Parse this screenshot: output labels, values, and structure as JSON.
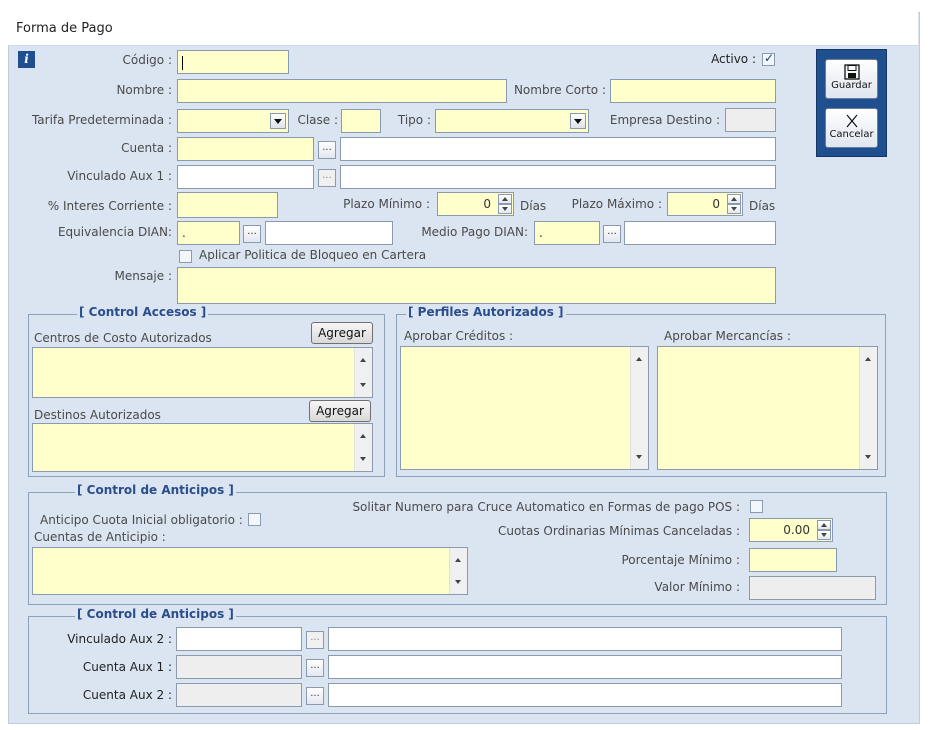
{
  "window": {
    "title": "Forma de Pago"
  },
  "icons": {
    "info": "info-icon",
    "save": "floppy-disk-icon",
    "cancel": "x-cancel-icon"
  },
  "toolbar": {
    "save_label": "Guardar",
    "cancel_label": "Cancelar"
  },
  "form": {
    "codigo_label": "Código :",
    "activo_label": "Activo :",
    "activo_checked": true,
    "nombre_label": "Nombre :",
    "nombre_corto_label": "Nombre Corto :",
    "tarifa_label": "Tarifa Predeterminada :",
    "clase_label": "Clase :",
    "tipo_label": "Tipo :",
    "empresa_destino_label": "Empresa Destino :",
    "cuenta_label": "Cuenta :",
    "vinculado_aux1_label": "Vinculado  Aux 1 :",
    "interes_label": "% Interes Corriente :",
    "plazo_minimo_label": "Plazo Mínimo :",
    "plazo_minimo_value": "0",
    "dias_label": "Días",
    "plazo_maximo_label": "Plazo Máximo :",
    "plazo_maximo_value": "0",
    "equivalencia_label": "Equivalencia DIAN:",
    "equivalencia_value": ".",
    "medio_pago_label": "Medio Pago DIAN:",
    "medio_pago_value": ".",
    "aplicar_politica_label": "Aplicar Politica de Bloqueo en Cartera",
    "mensaje_label": "Mensaje :",
    "ellipsis": "..."
  },
  "control_accesos": {
    "title": "[ Control Accesos ]",
    "centros_label": "Centros de Costo Autorizados",
    "destinos_label": "Destinos Autorizados",
    "agregar_label": "Agregar"
  },
  "perfiles": {
    "title": "[ Perfiles Autorizados ]",
    "aprobar_creditos_label": "Aprobar Créditos :",
    "aprobar_mercancias_label": "Aprobar Mercancías :"
  },
  "anticipos": {
    "title": "[ Control de Anticipos ]",
    "solicitar_label": "Solitar Numero para Cruce Automatico en Formas  de pago POS :",
    "anticipo_cuota_label": "Anticipo Cuota Inicial obligatorio :",
    "cuentas_anticipio_label": "Cuentas de Anticipio :",
    "cuotas_label": "Cuotas Ordinarias Mínimas Canceladas :",
    "cuotas_value": "0.00",
    "porcentaje_label": "Porcentaje Mínimo  :",
    "valor_label": "Valor Mínimo :"
  },
  "anticipos2": {
    "title": "[ Control de Anticipos ]",
    "vinculado_aux2_label": "Vinculado  Aux 2 :",
    "cuenta_aux1_label": "Cuenta Aux 1 :",
    "cuenta_aux2_label": "Cuenta Aux 2 :"
  }
}
